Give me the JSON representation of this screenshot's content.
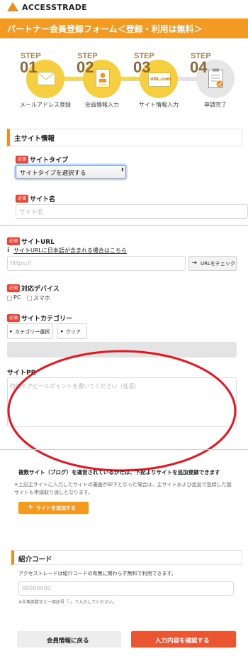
{
  "header": {
    "logo_text": "ACCESSTRADE"
  },
  "banner": {
    "title": "パートナー会員登録フォーム＜登録・利用は無料＞"
  },
  "steps": [
    {
      "label": "STEP",
      "num": "01",
      "caption": "メールアドレス登録",
      "icon": "envelope-icon",
      "active": true
    },
    {
      "label": "STEP",
      "num": "02",
      "caption": "会員情報入力",
      "icon": "profile-form-icon",
      "active": true
    },
    {
      "label": "STEP",
      "num": "03",
      "caption": "サイト情報入力",
      "icon": "url-screen-icon",
      "icon_text": "URL.com",
      "active": true
    },
    {
      "label": "STEP",
      "num": "04",
      "caption": "申請完了",
      "icon": "clipboard-check-icon",
      "active": false
    }
  ],
  "main_site": {
    "section_title": "主サイト情報",
    "required_badge": "必須",
    "site_type": {
      "label": "サイトタイプ",
      "selected": "サイトタイプを選択する"
    },
    "site_name": {
      "label": "サイト名",
      "placeholder": "サイト名"
    },
    "site_url": {
      "label": "サイトURL",
      "help_link": "サイトURLに日本語が含まれる場合はこちら",
      "placeholder": "https://",
      "check_button": "URLをチェック"
    },
    "devices": {
      "label": "対応デバイス",
      "options": [
        "PC",
        "スマホ"
      ]
    },
    "category": {
      "label": "サイトカテゴリー",
      "select_button": "カテゴリー選択",
      "clear_button": "クリア"
    },
    "site_pr": {
      "label": "サイトPR",
      "placeholder": "特徴やアピールポイントを書いてください（任意）"
    }
  },
  "multi_site": {
    "heading": "複数サイト（ブログ）を運営されているかたは、下記よりサイトを追加登録できます",
    "note": "上記主サイトに入力したサイトの審査が却下となった場合は、主サイトおよび追加で登録した副サイトも申請取り消しとなります。",
    "add_button": "サイトを追加する"
  },
  "referral": {
    "section_title": "紹介コード",
    "description": "アクセストレードは紹介コードの有無に関わらず無料で利用できます。",
    "placeholder": "00000000",
    "note": "※半角英数字と一部記号「-」で入力してください。"
  },
  "footer": {
    "back_button": "会員情報に戻る",
    "confirm_button": "入力内容を確認する"
  },
  "colors": {
    "brand_orange": "#f39a22",
    "required_red": "#e5483b",
    "step_yellow": "#f5cf3f",
    "annotation_red": "#e8141e"
  }
}
